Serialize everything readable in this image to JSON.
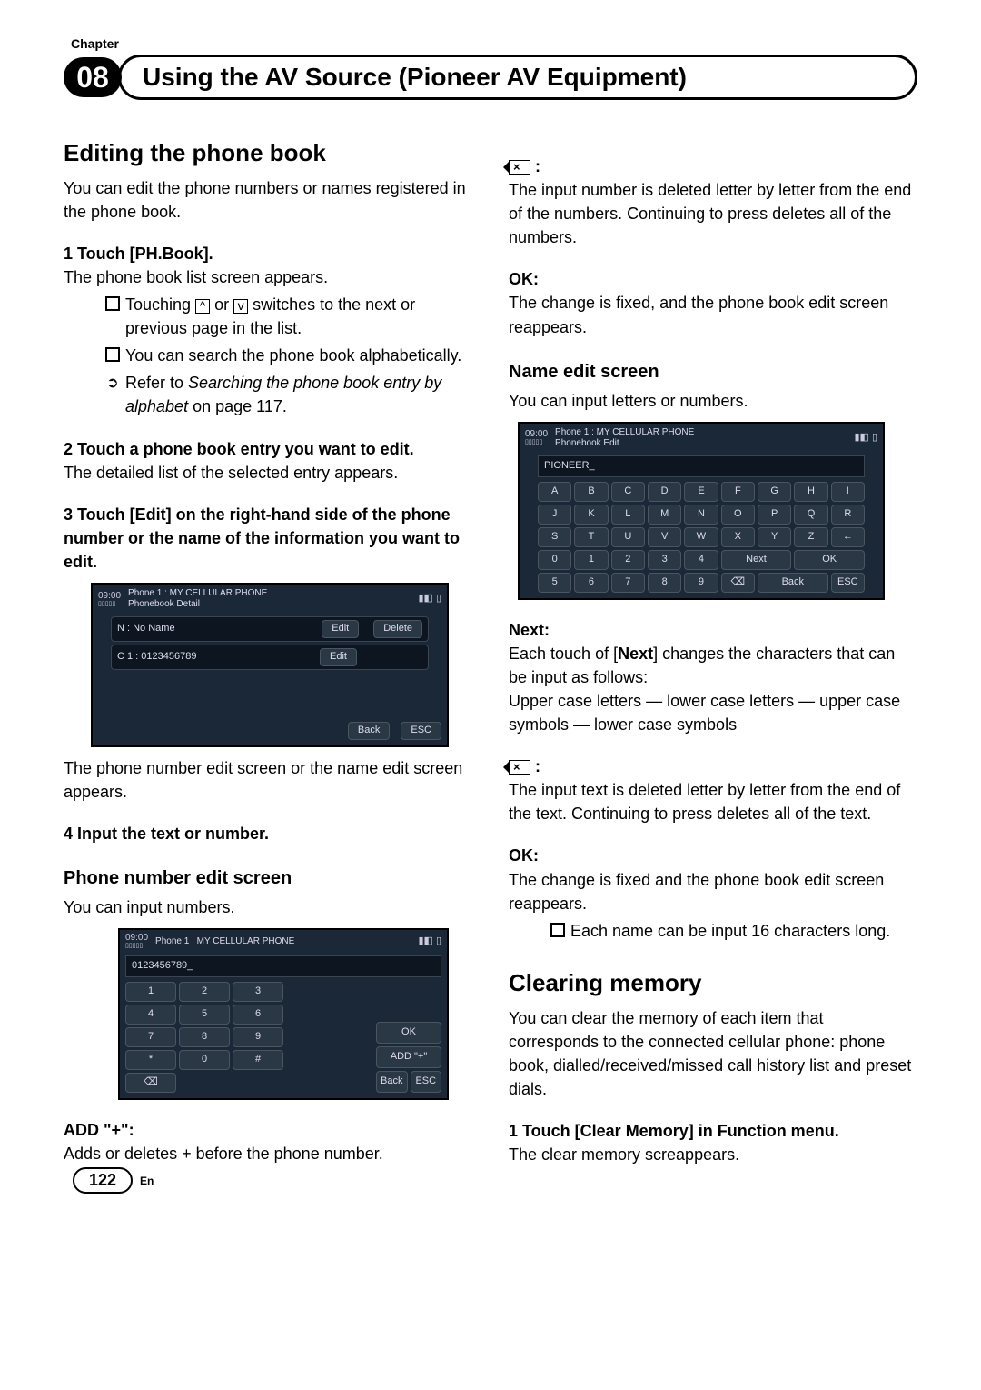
{
  "chapter_label": "Chapter",
  "chapter_num": "08",
  "title": "Using the AV Source (Pioneer AV Equipment)",
  "left": {
    "h2": "Editing the phone book",
    "intro": "You can edit the phone numbers or names registered in the phone book.",
    "s1": "1   Touch [PH.Book].",
    "s1b": "The phone book list screen appears.",
    "b1": "Touching ",
    "b1mid": " or ",
    "b1end": " switches to the next or previous page in the list.",
    "b2": "You can search the phone book alphabetically.",
    "b3a": "Refer to ",
    "b3i": "Searching the phone book entry by alphabet",
    "b3b": " on page 117.",
    "s2": "2   Touch a phone book entry you want to edit.",
    "s2b": "The detailed list of the selected entry appears.",
    "s3": "3   Touch [Edit] on the right-hand side of the phone number or the name of the information you want to edit.",
    "s3b": "The phone number edit screen or the name edit screen appears.",
    "s4": "4   Input the text or number.",
    "h3_phone": "Phone number edit screen",
    "phone_intro": "You can input numbers.",
    "add_h": "ADD \"+\":",
    "add_t": "Adds or deletes + before the phone number.",
    "fig1": {
      "time": "09:00",
      "phone": "Phone 1 : MY CELLULAR PHONE",
      "sub": "Phonebook Detail",
      "sig": "▮◧ ▯",
      "r1": "N : No Name",
      "r2": "C 1 : 0123456789",
      "edit": "Edit",
      "delete": "Delete",
      "back": "Back",
      "esc": "ESC"
    },
    "fig2": {
      "time": "09:00",
      "phone": "Phone 1 : MY CELLULAR PHONE",
      "sig": "▮◧ ▯",
      "value": "0123456789_",
      "k": [
        "1",
        "2",
        "3",
        "4",
        "5",
        "6",
        "7",
        "8",
        "9",
        "*",
        "0",
        "#"
      ],
      "bs": "⌫",
      "ok": "OK",
      "add": "ADD \"+\"",
      "back": "Back",
      "esc": "ESC"
    }
  },
  "right": {
    "bs_h": " :",
    "bs_t": "The input number is deleted letter by letter from the end of the numbers. Continuing to press deletes all of the numbers.",
    "ok_h": "OK:",
    "ok_t": "The change is fixed, and the phone book edit screen reappears.",
    "h3_name": "Name edit screen",
    "name_intro": "You can input letters or numbers.",
    "next_h": "Next:",
    "next_t1": "Each touch of [",
    "next_bold": "Next",
    "next_t2": "] changes the characters that can be input as follows:",
    "next_t3": "Upper case letters — lower case letters — upper case symbols — lower case symbols",
    "bs2_h": " :",
    "bs2_t": "The input text is deleted letter by letter from the end of the text. Continuing to press deletes all of the text.",
    "ok2_h": "OK:",
    "ok2_t": "The change is fixed and the phone book edit screen reappears.",
    "ok2_b": "Each name can be input 16 characters long.",
    "h2_clear": "Clearing memory",
    "clear_t": "You can clear the memory of each item that corresponds to the connected cellular phone: phone book, dialled/received/missed call history list and preset dials.",
    "clear_s1": "1   Touch [Clear Memory] in Function menu.",
    "clear_s1b": "The clear memory screappears.",
    "fig3": {
      "time": "09:00",
      "phone": "Phone 1 : MY CELLULAR PHONE",
      "sub": "Phonebook Edit",
      "sig": "▮◧ ▯",
      "value": "PIONEER_",
      "row1": [
        "A",
        "B",
        "C",
        "D",
        "E",
        "F",
        "G",
        "H",
        "I"
      ],
      "row2": [
        "J",
        "K",
        "L",
        "M",
        "N",
        "O",
        "P",
        "Q",
        "R"
      ],
      "row3": [
        "S",
        "T",
        "U",
        "V",
        "W",
        "X",
        "Y",
        "Z",
        "←"
      ],
      "row4": [
        "0",
        "1",
        "2",
        "3",
        "4",
        "Next",
        "",
        "OK",
        ""
      ],
      "row5": [
        "5",
        "6",
        "7",
        "8",
        "9",
        "⌫",
        "Back",
        "",
        "ESC"
      ]
    }
  },
  "page": "122",
  "lang": "En"
}
